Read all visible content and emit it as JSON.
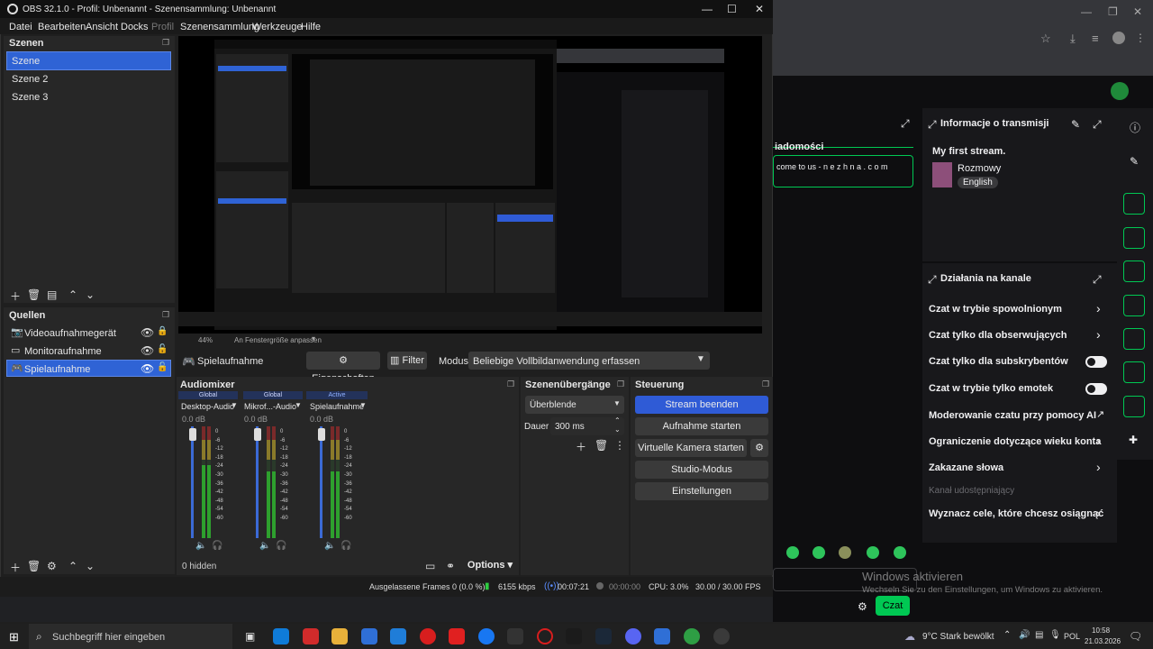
{
  "obs": {
    "title": "OBS 32.1.0 - Profil: Unbenannt - Szenensammlung: Unbenannt",
    "menu": [
      "Datei",
      "Bearbeiten",
      "Ansicht",
      "Docks",
      "Profil",
      "Szenensammlung",
      "Werkzeuge",
      "Hilfe"
    ],
    "scenes": {
      "title": "Szenen",
      "items": [
        "Szene",
        "Szene 2",
        "Szene 3"
      ]
    },
    "sources": {
      "title": "Quellen",
      "items": [
        "Videoaufnahmegerät",
        "Monitoraufnahme",
        "Spielaufnahme"
      ]
    },
    "preview_bar": {
      "zoom": "44%",
      "fit_label": "An Fenstergröße anpassen"
    },
    "source_bar": {
      "source_name": "Spielaufnahme",
      "properties_label": "Eigenschaften",
      "filter_label": "Filter",
      "mode_label": "Modus",
      "mode_value": "Beliebige Vollbildanwendung erfassen"
    },
    "audiomixer": {
      "title": "Audiomixer",
      "channels": [
        {
          "tag": "Global",
          "name": "Desktop-Audio",
          "db": "0.0 dB",
          "level": 0.65
        },
        {
          "tag": "Global",
          "name": "Mikrof...-Audio",
          "db": "0.0 dB",
          "level": 0.6
        },
        {
          "tag": "Active",
          "name": "Spielaufnahme",
          "db": "0.0 dB",
          "level": 0.6
        }
      ],
      "scale": [
        "0",
        "-6",
        "-12",
        "-18",
        "-24",
        "-30",
        "-36",
        "-42",
        "-48",
        "-54",
        "-60"
      ],
      "hidden_label": "0 hidden",
      "options_label": "Options"
    },
    "transitions": {
      "title": "Szenenübergänge",
      "transition_value": "Überblende",
      "duration_label": "Dauer",
      "duration_value": "300 ms"
    },
    "controls": {
      "title": "Steuerung",
      "stream": "Stream beenden",
      "record": "Aufnahme starten",
      "virtual_cam": "Virtuelle Kamera starten",
      "studio": "Studio-Modus",
      "settings": "Einstellungen"
    },
    "statusbar": {
      "dropped": "Ausgelassene Frames 0 (0.0 %)",
      "bitrate": "6155 kbps",
      "stream_time": "00:07:21",
      "record_time": "00:00:00",
      "cpu": "CPU: 3.0%",
      "fps": "30.00 / 30.00 FPS"
    }
  },
  "twitch": {
    "chat_header": "iadomości",
    "chat_welcome": "come to us - n e z h n a . c o m",
    "info_title": "Informacje o transmisji",
    "stream_title": "My first stream.",
    "category": "Rozmowy",
    "language": "English",
    "actions_title": "Działania na kanale",
    "actions": [
      {
        "label": "Czat w trybie spowolnionym",
        "control": "chevron"
      },
      {
        "label": "Czat tylko dla obserwujących",
        "control": "chevron"
      },
      {
        "label": "Czat tylko dla subskrybentów",
        "control": "toggle"
      },
      {
        "label": "Czat w trybie tylko emotek",
        "control": "toggle"
      },
      {
        "label": "Moderowanie czatu przy pomocy AI",
        "control": "external"
      },
      {
        "label": "Ograniczenie dotyczące wieku konta",
        "control": "chevron"
      },
      {
        "label": "Zakazane słowa",
        "control": "chevron"
      }
    ],
    "shared_channel": "Kanał udostępniający",
    "goals": "Wyznacz cele, które chcesz osiągnąć",
    "chat_button": "Czat"
  },
  "watermark": {
    "line1": "Windows aktivieren",
    "line2": "Wechseln Sie zu den Einstellungen, um Windows zu aktivieren."
  },
  "taskbar": {
    "search_placeholder": "Suchbegriff hier eingeben",
    "weather": "9°C  Stark bewölkt",
    "lang": "POL",
    "time": "10:58",
    "date": "21.03.2026"
  },
  "colors": {
    "accent": "#2f5bd6",
    "twitch_green": "#00c853",
    "obs_bg": "#1f1f1f"
  }
}
